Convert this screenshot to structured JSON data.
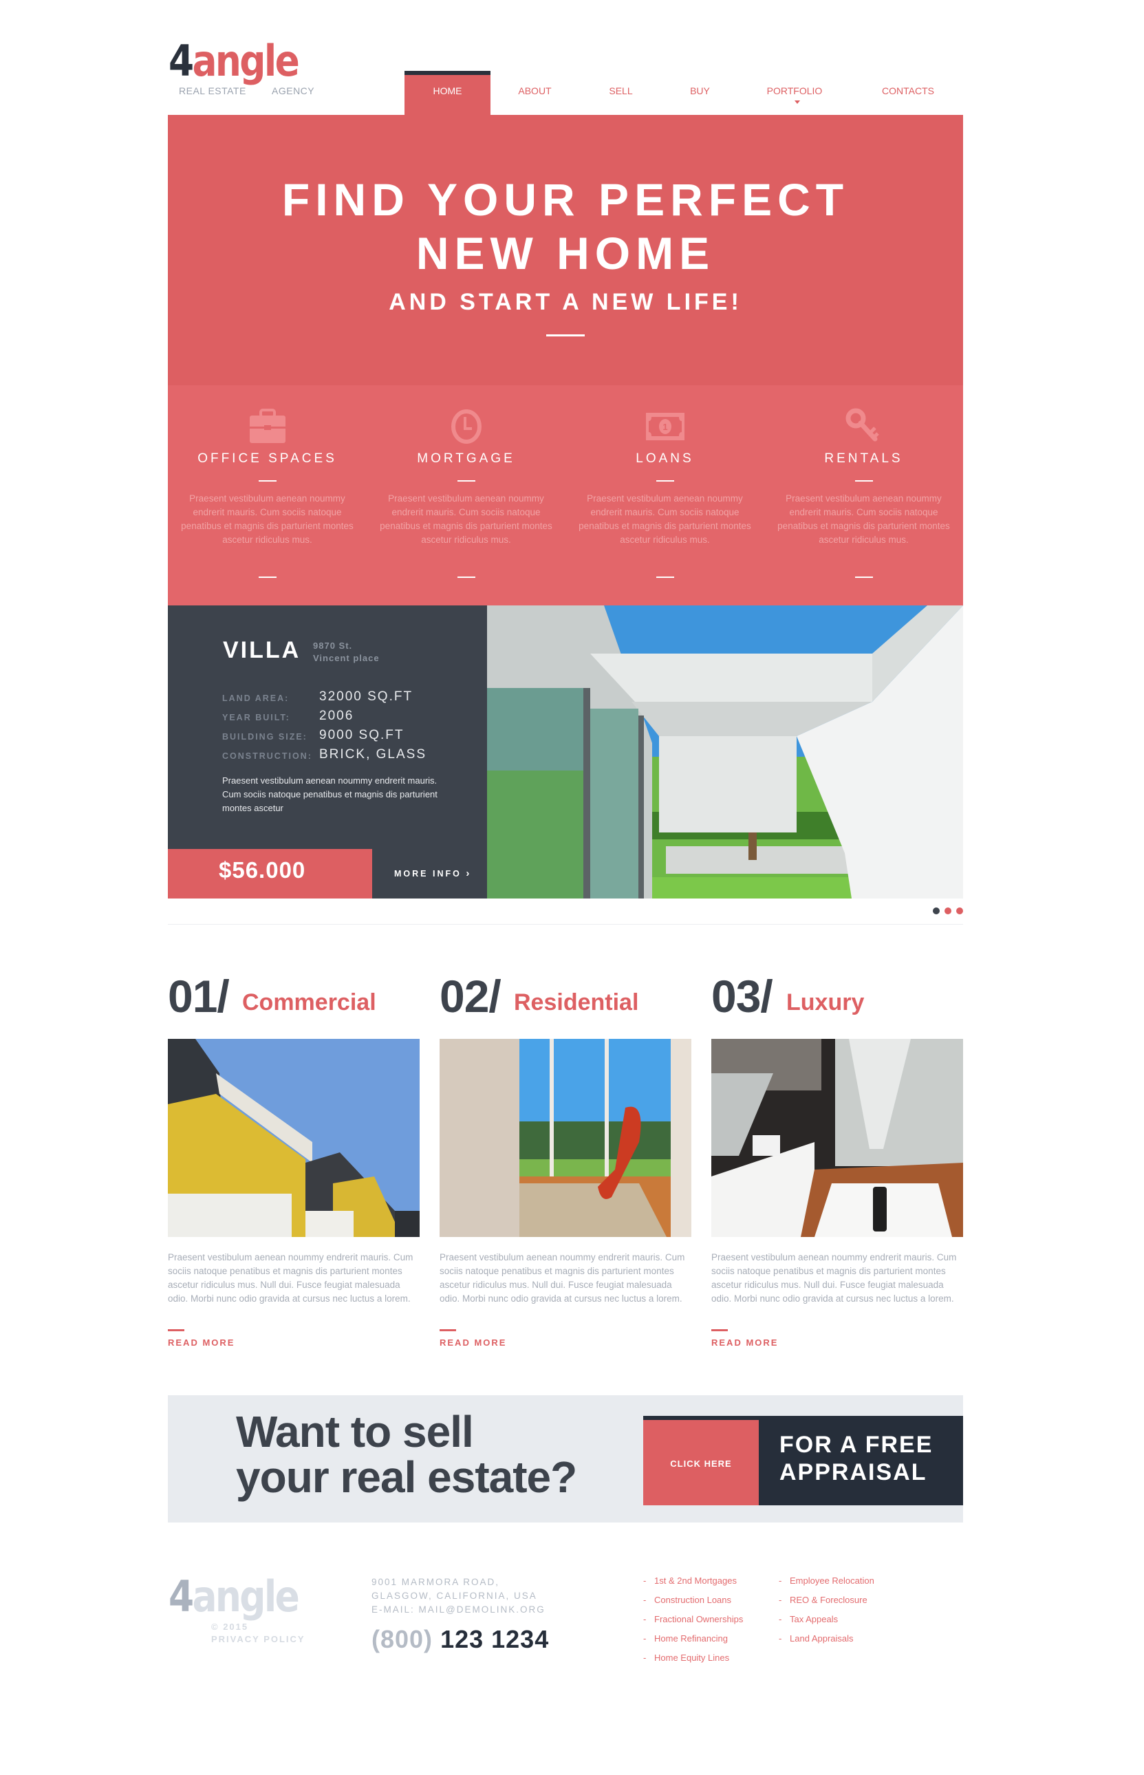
{
  "brand": {
    "logo_num": "4",
    "logo_word": "angle",
    "sub_left": "REAL ESTATE",
    "sub_right": "AGENCY"
  },
  "colors": {
    "accent": "#dd5f62",
    "dark": "#3d434c",
    "navy": "#262e3a",
    "banner_bg": "#e8ebef"
  },
  "nav": {
    "items": [
      {
        "label": "HOME",
        "active": true
      },
      {
        "label": "ABOUT"
      },
      {
        "label": "SELL"
      },
      {
        "label": "BUY"
      },
      {
        "label": "PORTFOLIO",
        "has_dropdown": true
      },
      {
        "label": "CONTACTS"
      }
    ]
  },
  "hero": {
    "line1": "FIND YOUR PERFECT",
    "line2": "NEW HOME",
    "subtitle": "AND START A NEW LIFE!"
  },
  "features": [
    {
      "icon": "briefcase-icon",
      "title": "OFFICE SPACES",
      "text": "Praesent vestibulum aenean noummy endrerit mauris. Cum sociis natoque penatibus et magnis dis parturient montes ascetur ridiculus mus."
    },
    {
      "icon": "clock-icon",
      "title": "MORTGAGE",
      "text": "Praesent vestibulum aenean noummy endrerit mauris. Cum sociis natoque penatibus et magnis dis parturient montes ascetur ridiculus mus."
    },
    {
      "icon": "banknote-icon",
      "title": "LOANS",
      "text": "Praesent vestibulum aenean noummy endrerit mauris. Cum sociis natoque penatibus et magnis dis parturient montes ascetur ridiculus mus."
    },
    {
      "icon": "key-icon",
      "title": "RENTALS",
      "text": "Praesent vestibulum aenean noummy endrerit mauris. Cum sociis natoque penatibus et magnis dis parturient montes ascetur ridiculus mus."
    }
  ],
  "villa": {
    "name": "VILLA",
    "address_line1": "9870 St.",
    "address_line2": "Vincent place",
    "specs": [
      {
        "label": "LAND AREA:",
        "value": "32000 SQ.FT"
      },
      {
        "label": "YEAR BUILT:",
        "value": "2006"
      },
      {
        "label": "BUILDING SIZE:",
        "value": "9000 SQ.FT"
      },
      {
        "label": "CONSTRUCTION:",
        "value": "BRICK, GLASS"
      }
    ],
    "description": "Praesent vestibulum aenean noummy endrerit mauris. Cum sociis natoque penatibus et magnis dis parturient montes ascetur",
    "price": "$56.000",
    "more_info": "MORE INFO",
    "slider": {
      "count": 3,
      "active_index": 0
    }
  },
  "categories": [
    {
      "number": "01/",
      "name": "Commercial",
      "text": "Praesent vestibulum aenean noummy endrerit mauris. Cum sociis natoque penatibus et magnis dis parturient montes ascetur ridiculus mus. Null dui. Fusce feugiat malesuada odio. Morbi nunc odio gravida at cursus nec luctus a lorem.",
      "read_more": "READ MORE"
    },
    {
      "number": "02/",
      "name": "Residential",
      "text": "Praesent vestibulum aenean noummy endrerit mauris. Cum sociis natoque penatibus et magnis dis parturient montes ascetur ridiculus mus. Null dui. Fusce feugiat malesuada odio. Morbi nunc odio gravida at cursus nec luctus a lorem.",
      "read_more": "READ MORE"
    },
    {
      "number": "03/",
      "name": "Luxury",
      "text": "Praesent vestibulum aenean noummy endrerit mauris. Cum sociis natoque penatibus et magnis dis parturient montes ascetur ridiculus mus. Null dui. Fusce feugiat malesuada odio. Morbi nunc odio gravida at cursus nec luctus a lorem.",
      "read_more": "READ MORE"
    }
  ],
  "sell_banner": {
    "line1": "Want to sell",
    "line2": "your real estate?",
    "button": "CLICK HERE",
    "cta_line1": "FOR A FREE",
    "cta_line2": "APPRAISAL"
  },
  "footer": {
    "logo_num": "4",
    "logo_word": "angle",
    "copyright": "© 2015",
    "privacy": "PRIVACY POLICY",
    "address_line1": "9001 MARMORA ROAD,",
    "address_line2": "GLASGOW, CALIFORNIA, USA",
    "email": "E-MAIL: MAIL@DEMOLINK.ORG",
    "phone_area": "(800)",
    "phone_number": "123 1234",
    "links_col1": [
      "1st & 2nd Mortgages",
      "Construction Loans",
      "Fractional Ownerships",
      "Home Refinancing",
      "Home Equity Lines"
    ],
    "links_col2": [
      "Employee Relocation",
      "REO & Foreclosure",
      "Tax Appeals",
      "Land Appraisals"
    ],
    "bullet": "-"
  }
}
